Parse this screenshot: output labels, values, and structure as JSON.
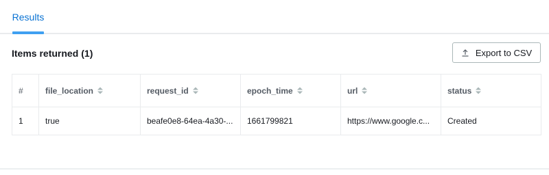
{
  "tabs": [
    {
      "label": "Results",
      "active": true
    }
  ],
  "section": {
    "title": "Items returned",
    "count": "(1)"
  },
  "export_button": {
    "label": "Export to CSV",
    "icon": "upload-icon"
  },
  "table": {
    "columns": [
      "#",
      "file_location",
      "request_id",
      "epoch_time",
      "url",
      "status"
    ],
    "rows": [
      [
        "1",
        "true",
        "beafe0e8-64ea-4a30-...",
        "1661799821",
        "https://www.google.c...",
        "Created"
      ]
    ]
  },
  "colors": {
    "accent": "#0972d3",
    "tab_underline": "#3fa0f1",
    "border": "#e9ebed"
  }
}
